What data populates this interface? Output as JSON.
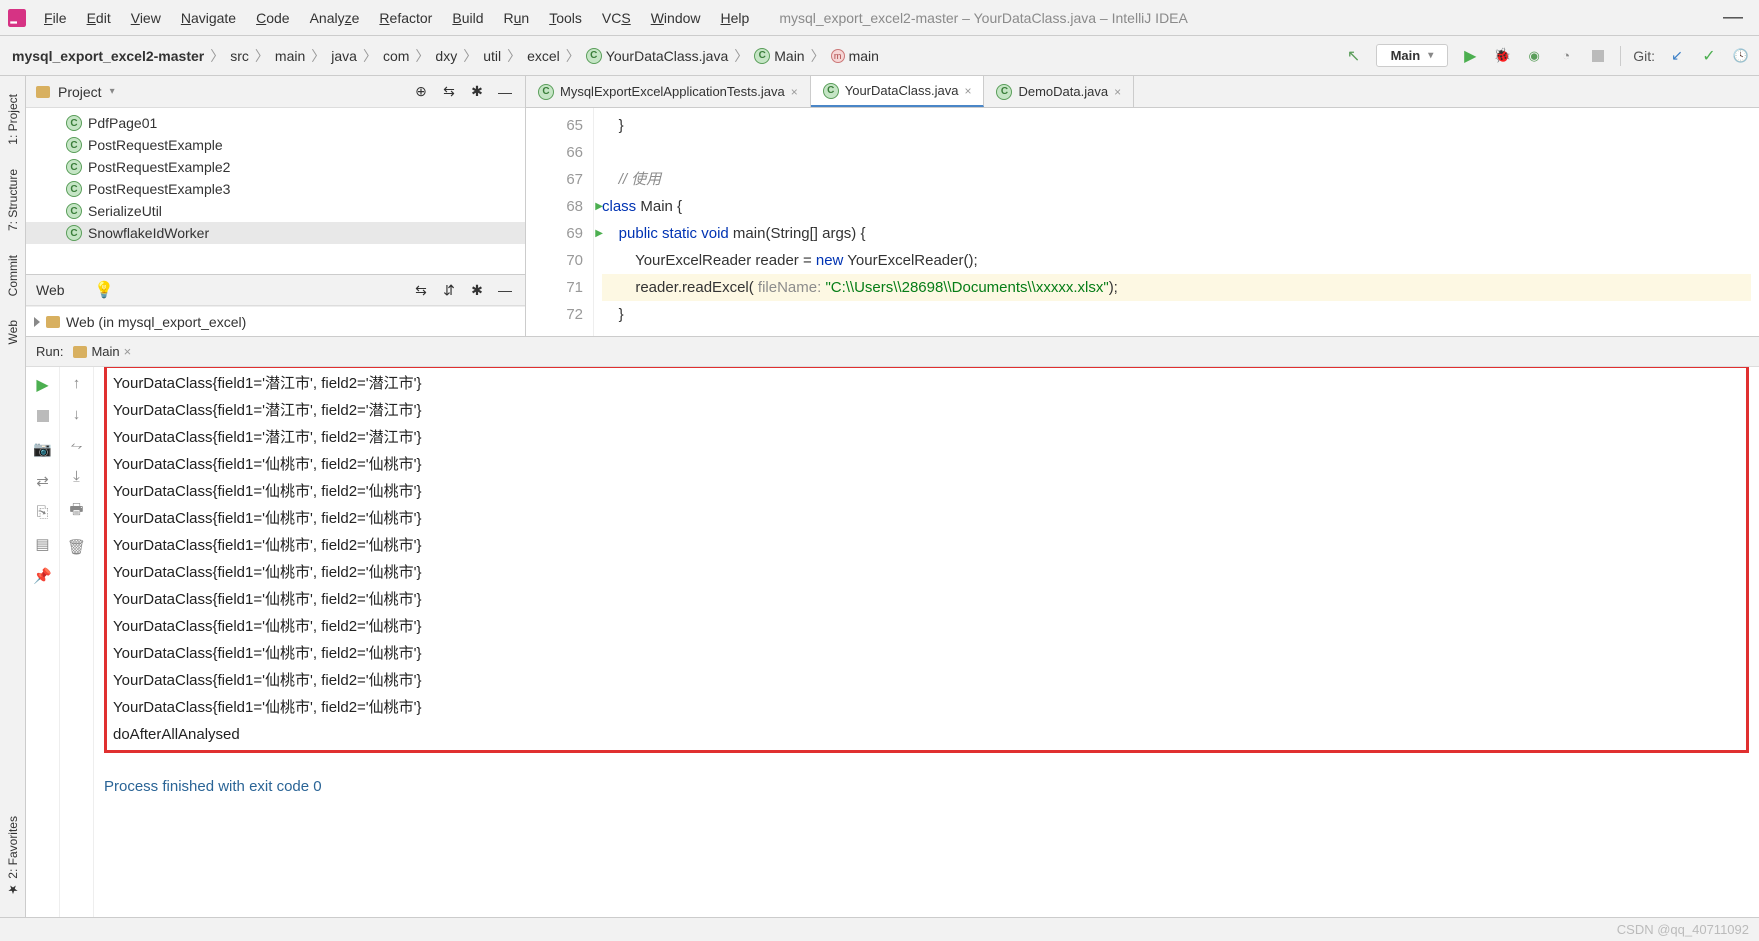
{
  "window_title": "mysql_export_excel2-master – YourDataClass.java – IntelliJ IDEA",
  "menu": [
    "File",
    "Edit",
    "View",
    "Navigate",
    "Code",
    "Analyze",
    "Refactor",
    "Build",
    "Run",
    "Tools",
    "VCS",
    "Window",
    "Help"
  ],
  "breadcrumbs": {
    "root": "mysql_export_excel2-master",
    "path": [
      "src",
      "main",
      "java",
      "com",
      "dxy",
      "util",
      "excel"
    ],
    "file": "YourDataClass.java",
    "class": "Main",
    "method": "main"
  },
  "run_config": "Main",
  "git_label": "Git:",
  "left_tabs": [
    "1: Project",
    "7: Structure",
    "Commit",
    "Web",
    "2: Favorites"
  ],
  "project_pane": {
    "title": "Project",
    "items": [
      "PdfPage01",
      "PostRequestExample",
      "PostRequestExample2",
      "PostRequestExample3",
      "SerializeUtil",
      "SnowflakeIdWorker"
    ]
  },
  "web_pane": {
    "title": "Web",
    "item": "Web (in mysql_export_excel)"
  },
  "editor_tabs": [
    {
      "name": "MysqlExportExcelApplicationTests.java",
      "active": false
    },
    {
      "name": "YourDataClass.java",
      "active": true
    },
    {
      "name": "DemoData.java",
      "active": false
    }
  ],
  "code": {
    "lines": [
      {
        "n": 65,
        "t": "    }"
      },
      {
        "n": 66,
        "t": ""
      },
      {
        "n": 67,
        "t": "    // 使用",
        "cmt": true
      },
      {
        "n": 68,
        "t": "class Main {",
        "run": true,
        "kw": [
          "class"
        ]
      },
      {
        "n": 69,
        "t": "    public static void main(String[] args) {",
        "run": true,
        "kw": [
          "public",
          "static",
          "void"
        ]
      },
      {
        "n": 70,
        "t": "        YourExcelReader reader = new YourExcelReader();",
        "kw": [
          "new"
        ]
      },
      {
        "n": 71,
        "t": "        reader.readExcel( fileName: \"C:\\\\Users\\\\28698\\\\Documents\\\\xxxxx.xlsx\");",
        "hl": true,
        "str": "\"C:\\\\Users\\\\28698\\\\Documents\\\\xxxxx.xlsx\"",
        "param": "fileName:"
      },
      {
        "n": 72,
        "t": "    }"
      }
    ]
  },
  "run": {
    "label": "Run:",
    "config": "Main",
    "output": [
      "YourDataClass{field1='潜江市', field2='潜江市'}",
      "YourDataClass{field1='潜江市', field2='潜江市'}",
      "YourDataClass{field1='潜江市', field2='潜江市'}",
      "YourDataClass{field1='仙桃市', field2='仙桃市'}",
      "YourDataClass{field1='仙桃市', field2='仙桃市'}",
      "YourDataClass{field1='仙桃市', field2='仙桃市'}",
      "YourDataClass{field1='仙桃市', field2='仙桃市'}",
      "YourDataClass{field1='仙桃市', field2='仙桃市'}",
      "YourDataClass{field1='仙桃市', field2='仙桃市'}",
      "YourDataClass{field1='仙桃市', field2='仙桃市'}",
      "YourDataClass{field1='仙桃市', field2='仙桃市'}",
      "YourDataClass{field1='仙桃市', field2='仙桃市'}",
      "YourDataClass{field1='仙桃市', field2='仙桃市'}",
      "doAfterAllAnalysed"
    ],
    "exit": "Process finished with exit code 0"
  },
  "footer": "CSDN @qq_40711092"
}
